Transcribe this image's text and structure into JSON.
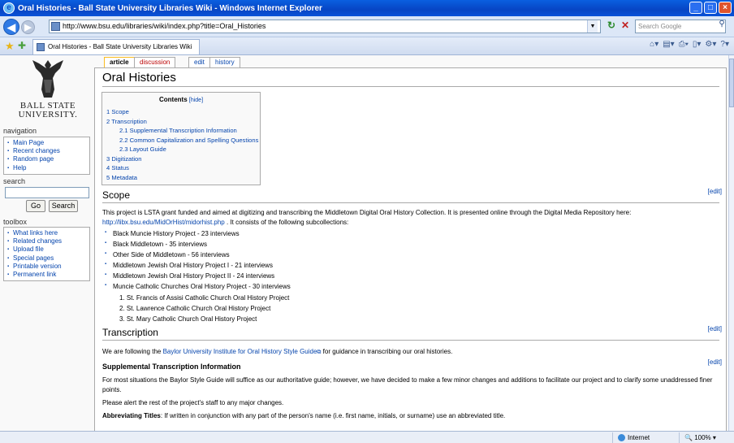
{
  "window": {
    "title": "Oral Histories - Ball State University Libraries Wiki - Windows Internet Explorer"
  },
  "address_bar": {
    "url": "http://www.bsu.edu/libraries/wiki/index.php?title=Oral_Histories",
    "search_placeholder": "Search Google"
  },
  "browser_tab": {
    "label": "Oral Histories - Ball State University Libraries Wiki"
  },
  "logo": {
    "line1": "BALL STATE",
    "line2": "UNIVERSITY."
  },
  "sidebar": {
    "navigation_title": "navigation",
    "navigation_items": [
      "Main Page",
      "Recent changes",
      "Random page",
      "Help"
    ],
    "search_title": "search",
    "go_label": "Go",
    "search_label": "Search",
    "toolbox_title": "toolbox",
    "toolbox_items": [
      "What links here",
      "Related changes",
      "Upload file",
      "Special pages",
      "Printable version",
      "Permanent link"
    ]
  },
  "page_tabs": {
    "article": "article",
    "discussion": "discussion",
    "edit": "edit",
    "history": "history"
  },
  "page": {
    "title": "Oral Histories",
    "toc": {
      "title": "Contents",
      "hide": "[hide]",
      "entries": [
        {
          "text": "1 Scope",
          "sub": false
        },
        {
          "text": "2 Transcription",
          "sub": false
        },
        {
          "text": "2.1 Supplemental Transcription Information",
          "sub": true
        },
        {
          "text": "2.2 Common Capitalization and Spelling Questions",
          "sub": true
        },
        {
          "text": "2.3 Layout Guide",
          "sub": true
        },
        {
          "text": "3 Digitization",
          "sub": false
        },
        {
          "text": "4 Status",
          "sub": false
        },
        {
          "text": "5 Metadata",
          "sub": false
        }
      ]
    },
    "edit_label": "[edit]",
    "scope": {
      "heading": "Scope",
      "para1": "This project is LSTA grant funded and aimed at digitizing and transcribing the Middletown Digital Oral History Collection. It is presented online through the Digital Media Repository here:",
      "link": "http://libx.bsu.edu/MidOrHist/midorhist.php",
      "para2": ". It consists of the following subcollections:",
      "items": [
        "Black Muncie History Project - 23 interviews",
        "Black Middletown - 35 interviews",
        "Other Side of Middletown - 56 interviews",
        "Middletown Jewish Oral History Project I - 21 interviews",
        "Middletown Jewish Oral History Project II - 24 interviews",
        "Muncie Catholic Churches Oral History Project - 30 interviews"
      ],
      "churches": [
        "1.   St. Francis of Assisi Catholic Church Oral History Project",
        "2.   St. Lawrence Catholic Church Oral History Project",
        "3.   St. Mary Catholic Church Oral History Project"
      ]
    },
    "transcription": {
      "heading": "Transcription",
      "para_prefix": "We are following the",
      "guide_link": "Baylor University Institute for Oral History Style Guide",
      "para_suffix": "for guidance in transcribing our oral histories.",
      "sub_heading": "Supplemental Transcription Information",
      "para2": "For most situations the Baylor Style Guide will suffice as our authoritative guide; however, we have decided to make a few minor changes and additions to facilitate our project and to clarify some unaddressed finer points.",
      "para3": "Please alert the rest of the project's staff to any major changes.",
      "abbrev_label": "Abbreviating Titles",
      "abbrev_text": ": If written in conjunction with any part of the person's name (i.e. first name, initials, or surname) use an abbreviated title."
    }
  },
  "status_bar": {
    "zone": "Internet",
    "zoom": "100%"
  },
  "colors": {
    "link": "#0645ad",
    "new_link": "#ba0000",
    "titlebar": "#0a52d8"
  }
}
